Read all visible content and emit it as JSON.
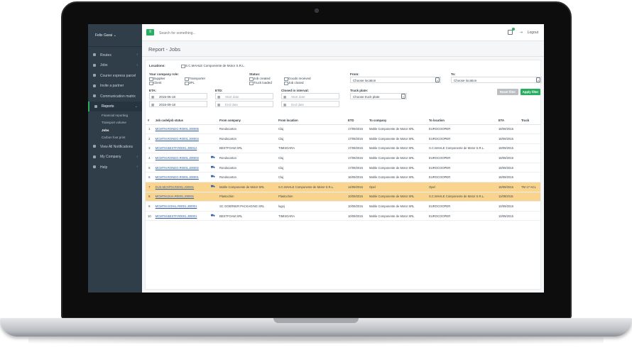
{
  "sidebar": {
    "user": "Felix Garai",
    "items": [
      {
        "label": "Routes"
      },
      {
        "label": "Jobs"
      },
      {
        "label": "Courier express parcel"
      },
      {
        "label": "Invite a partner"
      },
      {
        "label": "Communication matrix"
      },
      {
        "label": "Reports"
      },
      {
        "label": "View All Notifications"
      },
      {
        "label": "My Company"
      },
      {
        "label": "Help"
      }
    ],
    "subitems": [
      "Financial reporting",
      "Transport volume",
      "Jobs",
      "Carbon foot print"
    ]
  },
  "topbar": {
    "search_placeholder": "Search for something...",
    "logout": "Logout"
  },
  "page": {
    "title": "Report - Jobs"
  },
  "filters": {
    "locations_label": "Locations:",
    "location_value": "S.C.MAHLE Componente de Motor S.R.L.",
    "role_label": "Your company role:",
    "roles": [
      "Supplier",
      "Client",
      "Transporter",
      "3PL"
    ],
    "status_label": "Status:",
    "statuses": [
      "Job created",
      "Truck loaded",
      "Goods received",
      "Job closed"
    ],
    "from_label": "From:",
    "from_value": "Choose location",
    "to_label": "To:",
    "to_value": "Choose location",
    "eta_label": "ETA:",
    "eta_start": "2015-06-18",
    "eta_end": "2015-09-18",
    "etd_label": "ETD:",
    "etd_start": "Start date",
    "etd_end": "End date",
    "closed_label": "Closed in interval:",
    "closed_start": "Start date",
    "closed_end": "End date",
    "truck_label": "Truck plate:",
    "truck_value": "Choose truck plate",
    "reset_label": "Reset filter",
    "apply_label": "Apply filter"
  },
  "table": {
    "headers": [
      "#",
      "Job code/job status",
      "From company",
      "From location",
      "ETD",
      "To company",
      "To location",
      "ETA",
      "Truck"
    ],
    "rows": [
      {
        "n": "1",
        "code": "MCMTM.RONDO.R0001.J00005",
        "truck_icon": "",
        "from_company": "Rondocarton",
        "from_location": "Cluj",
        "etd": "17/09/2015",
        "to_company": "Mahle Componente de Motor SRL",
        "to_location": "EUROCOOPER",
        "eta": "18/09/2015",
        "truck": ""
      },
      {
        "n": "2",
        "code": "MCMTM.RONDO.R0001.J00004",
        "truck_icon": "",
        "from_company": "Rondocarton",
        "from_location": "Cluj",
        "etd": "17/09/2015",
        "to_company": "Mahle Componente de Motor SRL",
        "to_location": "EUROCOOPER",
        "eta": "18/09/2015",
        "truck": ""
      },
      {
        "n": "3",
        "code": "MCMTM.BESTF.R0001.J00012",
        "truck_icon": "",
        "from_company": "BESTFOAM SRL",
        "from_location": "TIMISOARA",
        "etd": "17/09/2015",
        "to_company": "Mahle Componente de Motor SRL",
        "to_location": "S.C.MAHLE Componente de Motor S.R.L.",
        "eta": "18/09/2015",
        "truck": ""
      },
      {
        "n": "4",
        "code": "MCMTM.RONDO.R0001.J00003",
        "truck_icon": "truck",
        "from_company": "Rondocarton",
        "from_location": "Cluj",
        "etd": "17/09/2015",
        "to_company": "Mahle Componente de Motor SRL",
        "to_location": "EUROCOOPER",
        "eta": "18/09/2015",
        "truck": ""
      },
      {
        "n": "5",
        "code": "MCMTM.RONDO.R0001.J00002",
        "truck_icon": "truck",
        "from_company": "Rondocarton",
        "from_location": "Cluj",
        "etd": "17/09/2015",
        "to_company": "Mahle Componente de Motor SRL",
        "to_location": "EUROCOOPER",
        "eta": "18/09/2015",
        "truck": ""
      },
      {
        "n": "6",
        "code": "MCMTM.RONDO.R0001.J00001",
        "truck_icon": "truck",
        "from_company": "Rondocarton",
        "from_location": "Cluj",
        "etd": "16/09/2015",
        "to_company": "Mahle Componente de Motor SRL",
        "to_location": "EUROCOOPER",
        "eta": "18/09/2015",
        "truck": ""
      },
      {
        "n": "7",
        "code": "DUS.MCMTM.R0001.J00001",
        "truck_icon": "truck",
        "from_company": "Mahle Componente de Motor SRL",
        "from_location": "S.C.MAHLE Componente de Motor S.R.L.",
        "etd": "14/09/2015",
        "to_company": "Opel",
        "to_location": "Opel",
        "eta": "15/09/2015",
        "truck": "TM 17 ACL"
      },
      {
        "n": "8",
        "code": "MCMTM.DUA.R0001.J00001",
        "truck_icon": "",
        "from_company": "Plastochim",
        "from_location": "Plastochim",
        "etd": "10/09/2015",
        "to_company": "Mahle Componente de Motor SRL",
        "to_location": "S.C.MAHLE Componente de Motor S.R.L.",
        "eta": "11/09/2015",
        "truck": ""
      },
      {
        "n": "9",
        "code": "MCMTM.GOHIL.R0001.J00001",
        "truck_icon": "",
        "from_company": "SC GOERNER PACKAGING SRL",
        "from_location": "lugoj",
        "etd": "10/09/2015",
        "to_company": "Mahle Componente de Motor SRL",
        "to_location": "EUROCOOPER",
        "eta": "10/09/2015",
        "truck": ""
      },
      {
        "n": "10",
        "code": "MCMTM.BESTF.R0001.J00001",
        "truck_icon": "truck",
        "from_company": "BESTFOAM SRL",
        "from_location": "TIMISOARA",
        "etd": "10/09/2015",
        "to_company": "Mahle Componente de Motor SRL",
        "to_location": "EUROCOOPER",
        "eta": "10/09/2015",
        "truck": ""
      }
    ],
    "highlight_rows": [
      7,
      8
    ],
    "highlight_color": "#f9d48f"
  },
  "colors": {
    "accent": "#27ae60",
    "sidebar": "#2f3e48",
    "link": "#2e5ea8"
  }
}
